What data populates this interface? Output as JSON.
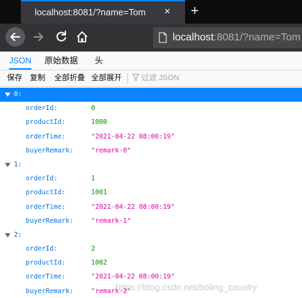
{
  "browser": {
    "tab_title": "localhost:8081/?name=Tom",
    "tab_close_icon": "×",
    "new_tab_icon": "+",
    "url_host": "localhost",
    "url_rest": ":8081/?name=Tom"
  },
  "viewer": {
    "tabs": [
      {
        "label": "JSON",
        "active": true
      },
      {
        "label": "原始数据",
        "active": false
      },
      {
        "label": "头",
        "active": false
      }
    ],
    "toolbar": {
      "save": "保存",
      "copy": "复制",
      "collapse_all": "全部折叠",
      "expand_all": "全部展开",
      "filter_placeholder": "过滤 JSON"
    }
  },
  "records": [
    {
      "index": "0:",
      "orderId_key": "orderId:",
      "orderId": "0",
      "productId_key": "productId:",
      "productId": "1000",
      "orderTime_key": "orderTime:",
      "orderTime": "\"2021-04-22 08:00:19\"",
      "buyerRemark_key": "buyerRemark:",
      "buyerRemark": "\"remark-0\""
    },
    {
      "index": "1:",
      "orderId_key": "orderId:",
      "orderId": "1",
      "productId_key": "productId:",
      "productId": "1001",
      "orderTime_key": "orderTime:",
      "orderTime": "\"2021-04-22 08:00:19\"",
      "buyerRemark_key": "buyerRemark:",
      "buyerRemark": "\"remark-1\""
    },
    {
      "index": "2:",
      "orderId_key": "orderId:",
      "orderId": "2",
      "productId_key": "productId:",
      "productId": "1002",
      "orderTime_key": "orderTime:",
      "orderTime": "\"2021-04-22 08:00:19\"",
      "buyerRemark_key": "buyerRemark:",
      "buyerRemark": "\"remark-2\""
    }
  ],
  "watermark": "https://blog.csdn.net/boling_cavalry",
  "colors": {
    "accent": "#0a84ff",
    "key": "#0074e8",
    "number": "#058b00",
    "string": "#dd00a9"
  }
}
